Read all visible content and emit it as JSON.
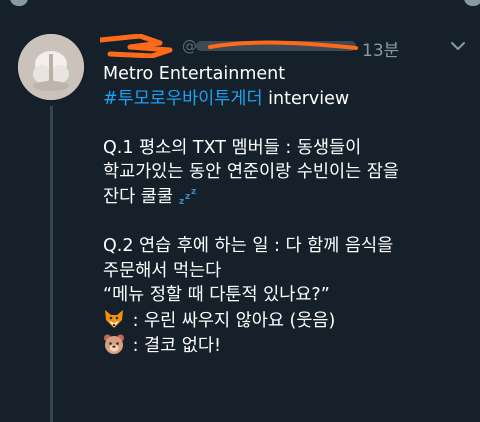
{
  "header": {
    "time": "13분",
    "caret": "chevron-down-icon"
  },
  "tweet": {
    "line1": "Metro Entertainment",
    "hashtag": "#투모로우바이투게더",
    "line2_rest": " interview",
    "q1_line1": "Q.1 평소의 TXT 멤버들 : 동생들이",
    "q1_line2": "학교가있는 동안 연준이랑 수빈이는 잠을",
    "q1_line3": "잔다 쿨쿨",
    "q1_zzz": "💤",
    "q2_line1": "Q.2 연습 후에 하는 일 : 다 함께 음식을",
    "q2_line2": "주문해서 먹는다",
    "q2_line3": "“메뉴 정할 때 다툰적 있나요?”",
    "a1": " : 우린 싸우지 않아요 (웃음)",
    "a2": " : 결코 없다!"
  },
  "icons": {
    "avatar": "avatar",
    "fox": "fox-emoji-icon",
    "bear": "bear-emoji-icon"
  },
  "colors": {
    "background": "#15202b",
    "hashtag": "#1da1f2",
    "muted": "#8899a6",
    "redaction": "#ff6a1a"
  }
}
